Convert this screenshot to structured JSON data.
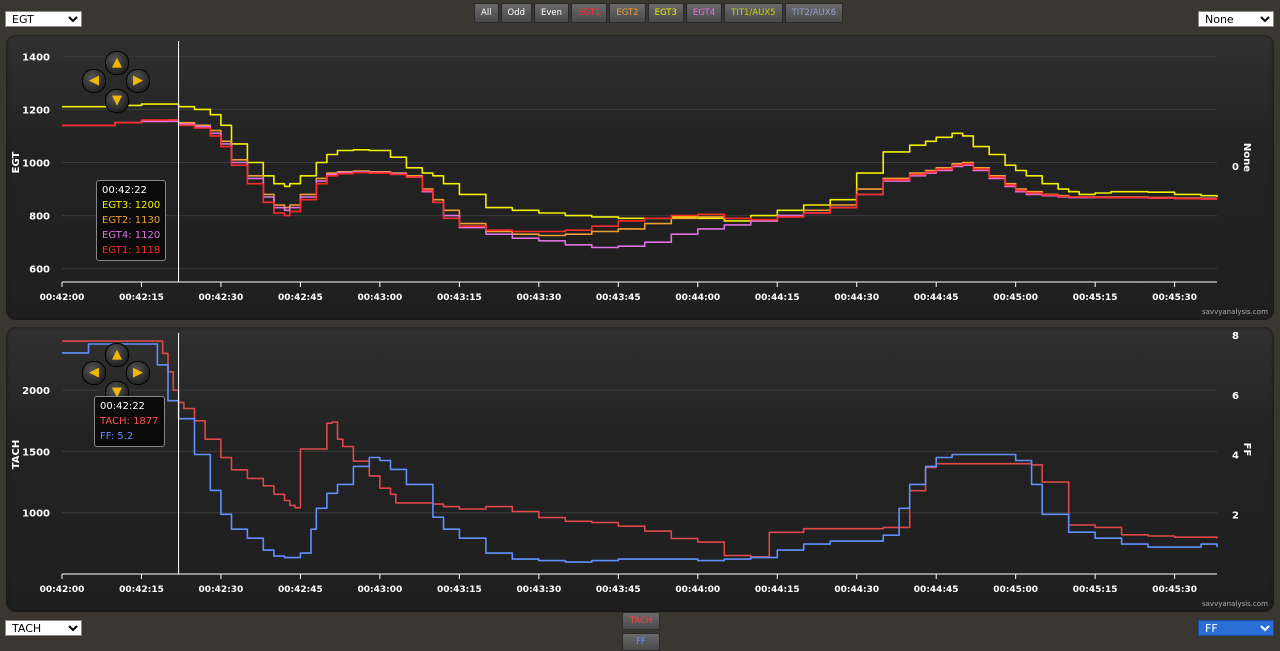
{
  "controls": {
    "top_left_select": "EGT",
    "top_right_select": "None",
    "bottom_left_select": "TACH",
    "bottom_right_select": "FF"
  },
  "series_buttons": [
    {
      "label": "All",
      "color": "#ffffff"
    },
    {
      "label": "Odd",
      "color": "#ffffff"
    },
    {
      "label": "Even",
      "color": "#ffffff"
    },
    {
      "label": "EGT1",
      "color": "#ff2a2a"
    },
    {
      "label": "EGT2",
      "color": "#f0a030"
    },
    {
      "label": "EGT3",
      "color": "#f0f000"
    },
    {
      "label": "EGT4",
      "color": "#e070e0"
    },
    {
      "label": "TIT1/AUX5",
      "color": "#c8d000"
    },
    {
      "label": "TIT2/AUX6",
      "color": "#90a0d0"
    }
  ],
  "legend_buttons": [
    {
      "label": "TACH",
      "color": "#ff4040"
    },
    {
      "label": "FF",
      "color": "#6090ff"
    }
  ],
  "watermark": "savvyanalysis.com",
  "chart_data": [
    {
      "type": "line",
      "ylabel": "EGT",
      "y2label": "None",
      "y2_ticks": [
        "0"
      ],
      "ylim": [
        550,
        1450
      ],
      "yticks": [
        600,
        800,
        1000,
        1200,
        1400
      ],
      "x_tick_labels": [
        "00:42:00",
        "00:42:15",
        "00:42:30",
        "00:42:45",
        "00:43:00",
        "00:43:15",
        "00:43:30",
        "00:43:45",
        "00:44:00",
        "00:44:15",
        "00:44:30",
        "00:44:45",
        "00:45:00",
        "00:45:15",
        "00:45:30"
      ],
      "x_range_seconds": [
        0,
        218
      ],
      "cursor_time": "00:42:22",
      "series": [
        {
          "name": "EGT3",
          "color": "#f0f000",
          "x": [
            0,
            10,
            15,
            20,
            22,
            25,
            28,
            30,
            32,
            35,
            38,
            40,
            42,
            43,
            45,
            48,
            50,
            52,
            55,
            58,
            62,
            65,
            68,
            70,
            72,
            75,
            80,
            85,
            90,
            95,
            100,
            105,
            110,
            115,
            120,
            125,
            130,
            135,
            140,
            145,
            150,
            155,
            160,
            163,
            165,
            168,
            170,
            172,
            175,
            178,
            180,
            182,
            185,
            188,
            190,
            192,
            195,
            198,
            200,
            205,
            210,
            215,
            218
          ],
          "y": [
            1210,
            1215,
            1220,
            1220,
            1210,
            1200,
            1180,
            1140,
            1070,
            1000,
            950,
            920,
            910,
            920,
            950,
            1000,
            1030,
            1045,
            1048,
            1045,
            1020,
            980,
            960,
            950,
            920,
            880,
            830,
            820,
            810,
            800,
            795,
            790,
            790,
            795,
            790,
            780,
            800,
            820,
            840,
            860,
            960,
            1040,
            1065,
            1080,
            1095,
            1110,
            1100,
            1060,
            1030,
            990,
            970,
            950,
            920,
            900,
            890,
            880,
            885,
            890,
            890,
            888,
            880,
            875,
            870
          ]
        },
        {
          "name": "EGT2",
          "color": "#f0a030",
          "x": [
            0,
            10,
            15,
            20,
            22,
            25,
            28,
            30,
            32,
            35,
            38,
            40,
            42,
            43,
            45,
            48,
            50,
            52,
            55,
            58,
            62,
            65,
            68,
            70,
            72,
            75,
            80,
            85,
            90,
            95,
            100,
            105,
            110,
            115,
            120,
            125,
            130,
            135,
            140,
            145,
            150,
            155,
            160,
            163,
            165,
            168,
            170,
            172,
            175,
            178,
            180,
            182,
            185,
            188,
            190,
            192,
            195,
            198,
            200,
            205,
            210,
            215,
            218
          ],
          "y": [
            1140,
            1150,
            1155,
            1160,
            1150,
            1140,
            1120,
            1080,
            1010,
            950,
            880,
            840,
            830,
            840,
            880,
            940,
            960,
            965,
            968,
            965,
            960,
            950,
            900,
            860,
            820,
            770,
            740,
            730,
            725,
            730,
            740,
            750,
            770,
            790,
            795,
            790,
            780,
            800,
            820,
            840,
            900,
            940,
            960,
            970,
            980,
            995,
            1000,
            980,
            950,
            920,
            900,
            890,
            880,
            875,
            870,
            870,
            870,
            870,
            870,
            868,
            866,
            865,
            865
          ]
        },
        {
          "name": "EGT4",
          "color": "#e070e0",
          "x": [
            0,
            10,
            15,
            20,
            22,
            25,
            28,
            30,
            32,
            35,
            38,
            40,
            42,
            43,
            45,
            48,
            50,
            52,
            55,
            58,
            62,
            65,
            68,
            70,
            72,
            75,
            80,
            85,
            90,
            95,
            100,
            105,
            110,
            115,
            120,
            125,
            130,
            135,
            140,
            145,
            150,
            155,
            160,
            163,
            165,
            168,
            170,
            172,
            175,
            178,
            180,
            182,
            185,
            188,
            190,
            192,
            195,
            198,
            200,
            205,
            210,
            215,
            218
          ],
          "y": [
            1140,
            1150,
            1155,
            1155,
            1145,
            1135,
            1110,
            1070,
            1000,
            940,
            870,
            830,
            820,
            830,
            870,
            930,
            955,
            962,
            965,
            962,
            958,
            945,
            890,
            850,
            800,
            755,
            730,
            715,
            705,
            690,
            680,
            685,
            700,
            730,
            750,
            765,
            780,
            800,
            810,
            830,
            880,
            930,
            950,
            960,
            970,
            985,
            990,
            970,
            940,
            910,
            890,
            880,
            875,
            870,
            868,
            868,
            868,
            868,
            868,
            866,
            865,
            864,
            864
          ]
        },
        {
          "name": "EGT1",
          "color": "#ff2a2a",
          "x": [
            0,
            10,
            15,
            20,
            22,
            25,
            28,
            30,
            32,
            35,
            38,
            40,
            42,
            43,
            45,
            48,
            50,
            52,
            55,
            58,
            62,
            65,
            68,
            70,
            72,
            75,
            80,
            85,
            90,
            95,
            100,
            105,
            110,
            115,
            120,
            125,
            130,
            135,
            140,
            145,
            150,
            155,
            160,
            163,
            165,
            168,
            170,
            172,
            175,
            178,
            180,
            182,
            185,
            188,
            190,
            192,
            195,
            198,
            200,
            205,
            210,
            215,
            218
          ],
          "y": [
            1140,
            1150,
            1160,
            1160,
            1140,
            1130,
            1100,
            1060,
            990,
            920,
            850,
            810,
            800,
            815,
            860,
            920,
            950,
            958,
            962,
            960,
            955,
            945,
            895,
            850,
            790,
            760,
            745,
            740,
            740,
            745,
            760,
            780,
            790,
            800,
            805,
            790,
            785,
            795,
            810,
            830,
            880,
            935,
            955,
            965,
            975,
            990,
            995,
            975,
            945,
            915,
            895,
            885,
            878,
            872,
            870,
            870,
            868,
            868,
            868,
            866,
            864,
            862,
            862
          ]
        }
      ],
      "tooltip": {
        "time": "00:42:22",
        "entries": [
          {
            "label": "EGT3",
            "value": "1200",
            "color": "#f0f000"
          },
          {
            "label": "EGT2",
            "value": "1130",
            "color": "#f0a030"
          },
          {
            "label": "EGT4",
            "value": "1120",
            "color": "#e070e0"
          },
          {
            "label": "EGT1",
            "value": "1118",
            "color": "#ff2a2a"
          }
        ]
      }
    },
    {
      "type": "line",
      "ylabel": "TACH",
      "y2label": "FF",
      "ylim": [
        500,
        2450
      ],
      "yticks": [
        1000,
        1500,
        2000
      ],
      "y2lim": [
        0,
        8
      ],
      "y2ticks": [
        2,
        4,
        6,
        8
      ],
      "x_tick_labels": [
        "00:42:00",
        "00:42:15",
        "00:42:30",
        "00:42:45",
        "00:43:00",
        "00:43:15",
        "00:43:30",
        "00:43:45",
        "00:44:00",
        "00:44:15",
        "00:44:30",
        "00:44:45",
        "00:45:00",
        "00:45:15",
        "00:45:30"
      ],
      "x_range_seconds": [
        0,
        218
      ],
      "cursor_time": "00:42:22",
      "series": [
        {
          "name": "TACH",
          "color": "#e04848",
          "axis": "left",
          "x": [
            0,
            10,
            17,
            19,
            20,
            21,
            22,
            23,
            25,
            27,
            30,
            32,
            35,
            38,
            40,
            42,
            43,
            44,
            45,
            48,
            49,
            50,
            51,
            52,
            53,
            55,
            58,
            60,
            62,
            63,
            65,
            70,
            72,
            75,
            80,
            85,
            90,
            95,
            100,
            105,
            110,
            115,
            120,
            125,
            130,
            133,
            133.5,
            140,
            150,
            155,
            160,
            163,
            165,
            168,
            170,
            175,
            180,
            183,
            185,
            190,
            195,
            200,
            205,
            210,
            215,
            218
          ],
          "y": [
            2400,
            2400,
            2400,
            2300,
            2150,
            2000,
            1900,
            1850,
            1750,
            1600,
            1450,
            1350,
            1280,
            1220,
            1150,
            1100,
            1060,
            1040,
            1520,
            1520,
            1520,
            1730,
            1740,
            1600,
            1540,
            1420,
            1300,
            1200,
            1150,
            1080,
            1080,
            1070,
            1050,
            1030,
            1050,
            1010,
            960,
            930,
            920,
            890,
            850,
            790,
            760,
            650,
            640,
            640,
            840,
            870,
            870,
            880,
            1180,
            1370,
            1400,
            1400,
            1400,
            1400,
            1400,
            1390,
            1250,
            900,
            880,
            820,
            810,
            800,
            800,
            790
          ]
        },
        {
          "name": "FF",
          "color": "#6090ff",
          "axis": "right",
          "x": [
            0,
            5,
            10,
            17,
            18,
            20,
            22,
            25,
            28,
            30,
            32,
            35,
            38,
            40,
            42,
            44,
            45,
            47,
            48,
            50,
            52,
            55,
            58,
            60,
            62,
            65,
            70,
            72,
            75,
            80,
            85,
            90,
            95,
            100,
            105,
            110,
            115,
            120,
            125,
            130,
            133,
            135,
            140,
            145,
            150,
            153,
            155,
            158,
            160,
            163,
            165,
            168,
            170,
            172,
            175,
            180,
            183,
            185,
            190,
            195,
            200,
            205,
            210,
            215,
            218
          ],
          "y": [
            7.4,
            7.7,
            7.7,
            7.7,
            7.0,
            5.8,
            5.2,
            4.0,
            2.8,
            2.0,
            1.5,
            1.2,
            0.8,
            0.6,
            0.55,
            0.55,
            0.7,
            1.5,
            2.2,
            2.7,
            3.0,
            3.6,
            3.9,
            3.8,
            3.5,
            3.0,
            1.9,
            1.5,
            1.2,
            0.7,
            0.5,
            0.45,
            0.4,
            0.45,
            0.5,
            0.5,
            0.5,
            0.45,
            0.5,
            0.55,
            0.55,
            0.8,
            1.0,
            1.1,
            1.1,
            1.1,
            1.3,
            2.2,
            3.0,
            3.6,
            3.9,
            4.0,
            4.0,
            4.0,
            4.0,
            3.8,
            3.0,
            2.0,
            1.4,
            1.2,
            1.0,
            0.9,
            0.9,
            1.0,
            0.9
          ]
        }
      ],
      "tooltip": {
        "time": "00:42:22",
        "entries": [
          {
            "label": "TACH",
            "value": "1877",
            "color": "#ff5050"
          },
          {
            "label": "FF",
            "value": "5.2",
            "color": "#6090ff"
          }
        ]
      }
    }
  ]
}
